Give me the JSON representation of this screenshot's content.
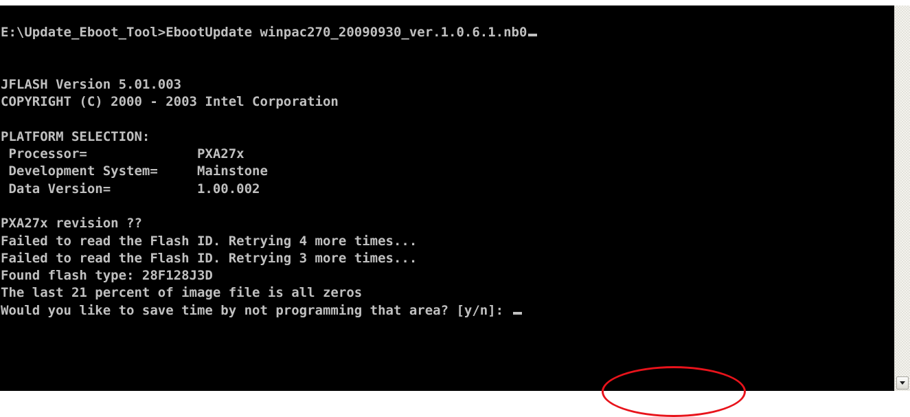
{
  "console": {
    "lines": [
      "E:\\Update_Eboot_Tool>EbootUpdate winpac270_20090930_ver.1.0.6.1.nb0",
      "",
      "",
      "JFLASH Version 5.01.003",
      "COPYRIGHT (C) 2000 - 2003 Intel Corporation",
      "",
      "PLATFORM SELECTION:",
      " Processor=              PXA27x",
      " Development System=     Mainstone",
      " Data Version=           1.00.002",
      "",
      "PXA27x revision ??",
      "Failed to read the Flash ID. Retrying 4 more times...",
      "Failed to read the Flash ID. Retrying 3 more times...",
      "Found flash type: 28F128J3D",
      "The last 21 percent of image file is all zeros",
      "Would you like to save time by not programming that area? [y/n]: "
    ]
  },
  "colors": {
    "console_background": "#000000",
    "console_text": "#c0c0c0",
    "highlight": "#e8131b",
    "scrollbar_track": "#f4f3ee"
  },
  "icons": {
    "scroll_down": "scroll-down-arrow-icon"
  }
}
